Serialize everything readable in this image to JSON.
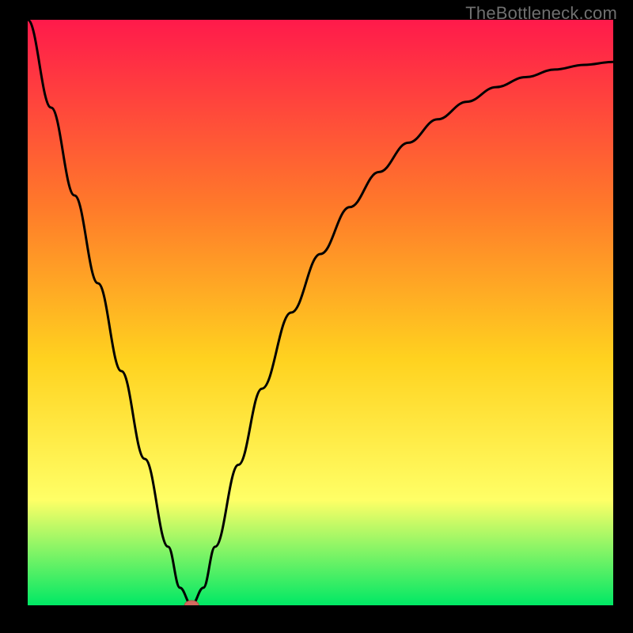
{
  "attribution": "TheBottleneck.com",
  "colors": {
    "frame": "#000000",
    "curve": "#000000",
    "marker_fill": "#d46a5f",
    "marker_stroke": "#b05048",
    "gradient_top": "#ff1a4b",
    "gradient_mid1": "#ff7a2a",
    "gradient_mid2": "#ffd21f",
    "gradient_mid3": "#ffff66",
    "gradient_bottom": "#00e865"
  },
  "chart_data": {
    "type": "line",
    "title": "",
    "xlabel": "",
    "ylabel": "",
    "xlim": [
      0,
      100
    ],
    "ylim": [
      0,
      100
    ],
    "grid": false,
    "legend": false,
    "series": [
      {
        "name": "bottleneck-curve",
        "x": [
          0,
          4,
          8,
          12,
          16,
          20,
          24,
          26,
          28,
          30,
          32,
          36,
          40,
          45,
          50,
          55,
          60,
          65,
          70,
          75,
          80,
          85,
          90,
          95,
          100
        ],
        "y": [
          100,
          85,
          70,
          55,
          40,
          25,
          10,
          3,
          0,
          3,
          10,
          24,
          37,
          50,
          60,
          68,
          74,
          79,
          83,
          86,
          88.5,
          90.2,
          91.5,
          92.3,
          92.8
        ]
      }
    ],
    "annotations": [
      {
        "name": "optimal-marker",
        "shape": "pill",
        "x": 28,
        "y": 0
      }
    ]
  }
}
